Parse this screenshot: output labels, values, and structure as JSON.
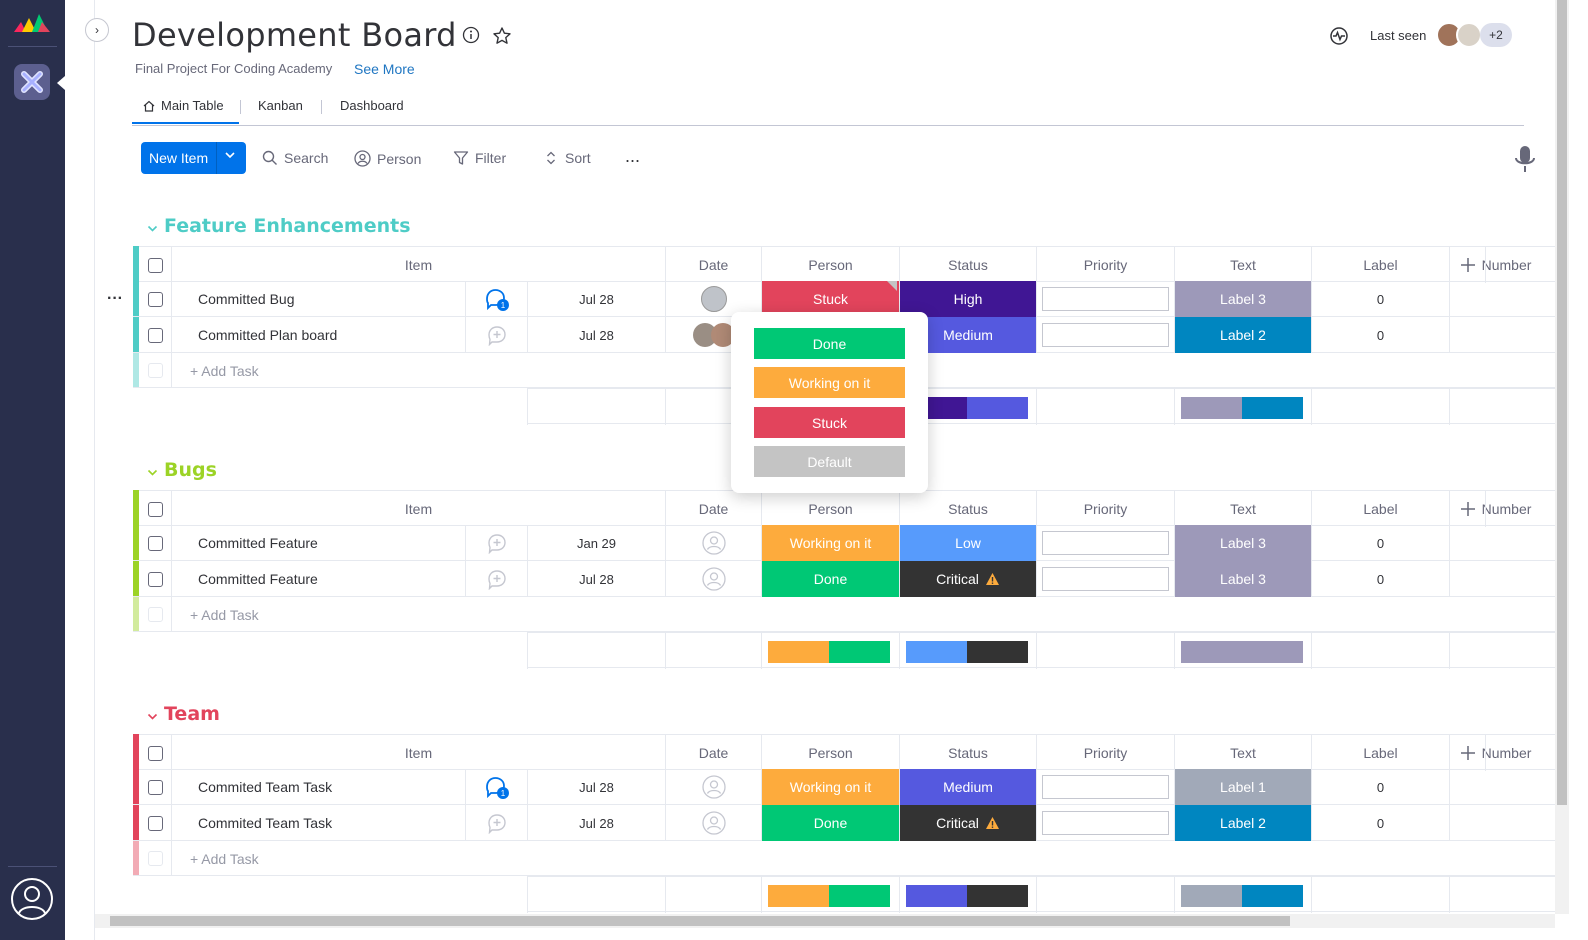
{
  "board": {
    "title": "Development Board",
    "description": "Final Project For Coding Academy",
    "see_more": "See More",
    "last_seen_label": "Last seen",
    "avatars_more": "+2"
  },
  "tabs": [
    "Main Table",
    "Kanban",
    "Dashboard"
  ],
  "toolbar": {
    "new_item": "New Item",
    "search": "Search",
    "person": "Person",
    "filter": "Filter",
    "sort": "Sort",
    "more": "..."
  },
  "columns": [
    "Item",
    "Date",
    "Person",
    "Status",
    "Priority",
    "Text",
    "Label",
    "Number"
  ],
  "add_task": "+ Add Task",
  "colors": {
    "done": "#00c875",
    "working": "#fdab3d",
    "stuck": "#e2445c",
    "default": "#c4c4c4",
    "high": "#401694",
    "medium": "#5559df",
    "low": "#579bfc",
    "critical": "#333333",
    "label1": "#a1a9b8",
    "label2": "#0086c0",
    "label3": "#9d99b9",
    "accent": "#0073ea"
  },
  "groups": [
    {
      "title": "Feature Enhancements",
      "color": "#4eccc6",
      "rows": [
        {
          "item": "Committed Bug",
          "date": "Jul 28",
          "status": "Stuck",
          "priority": "High",
          "label": "Label 3",
          "number": "0",
          "updates": "1"
        },
        {
          "item": "Committed Plan board",
          "date": "Jul 28",
          "status": "",
          "priority": "Medium",
          "label": "Label 2",
          "number": "0",
          "updates": ""
        }
      ]
    },
    {
      "title": "Bugs",
      "color": "#9cd326",
      "rows": [
        {
          "item": "Committed Feature",
          "date": "Jan 29",
          "status": "Working on it",
          "priority": "Low",
          "label": "Label 3",
          "number": "0",
          "updates": ""
        },
        {
          "item": "Committed Feature",
          "date": "Jul 28",
          "status": "Done",
          "priority": "Critical",
          "label": "Label 3",
          "number": "0",
          "updates": ""
        }
      ]
    },
    {
      "title": "Team",
      "color": "#e2445c",
      "rows": [
        {
          "item": "Commited Team Task",
          "date": "Jul 28",
          "status": "Working on it",
          "priority": "Medium",
          "label": "Label 1",
          "number": "0",
          "updates": "1"
        },
        {
          "item": "Commited Team Task",
          "date": "Jul 28",
          "status": "Done",
          "priority": "Critical",
          "label": "Label 2",
          "number": "0",
          "updates": ""
        }
      ]
    }
  ],
  "status_popup": {
    "options": [
      "Done",
      "Working on it",
      "Stuck",
      "Default"
    ]
  }
}
